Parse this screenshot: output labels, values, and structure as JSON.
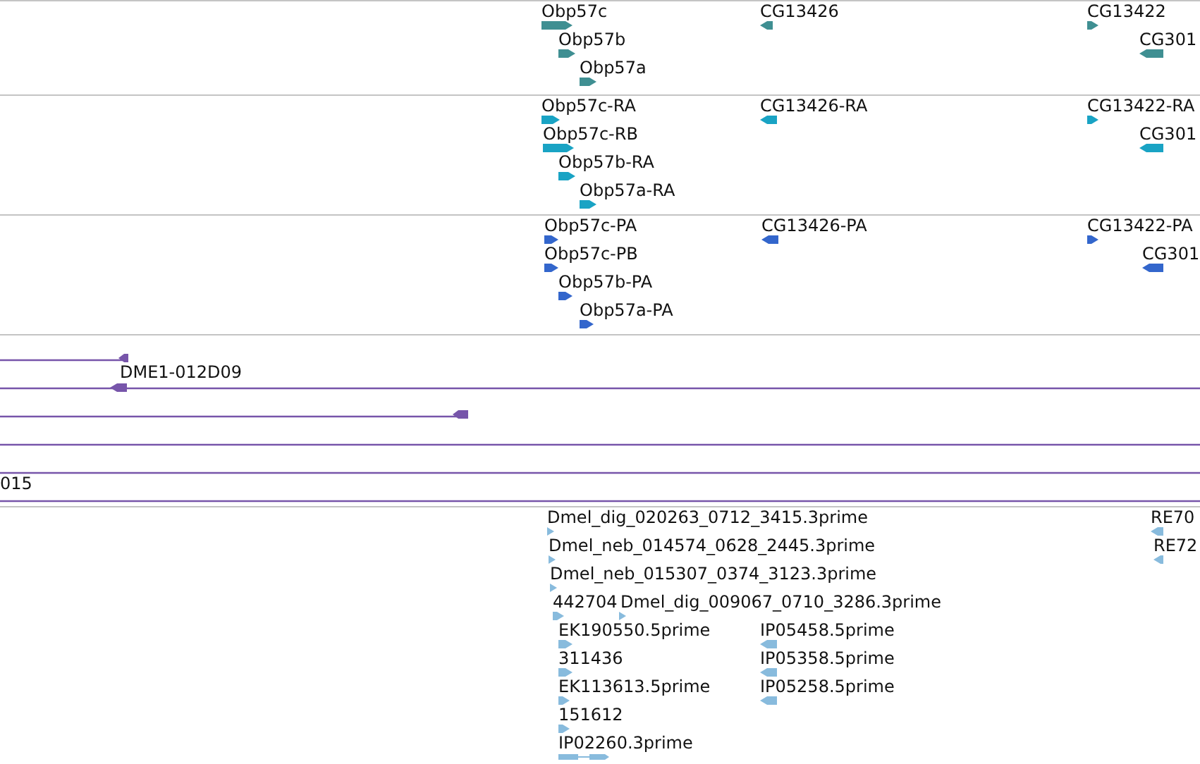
{
  "tracks": [
    {
      "color": "#3f8f92",
      "features": [
        {
          "label": "Obp57c",
          "reverse": false
        },
        {
          "label": "Obp57b",
          "reverse": false
        },
        {
          "label": "Obp57a",
          "reverse": false
        },
        {
          "label": "CG13426",
          "reverse": true
        },
        {
          "label": "CG13422",
          "reverse": false
        },
        {
          "label": "CG301",
          "reverse": true
        }
      ]
    },
    {
      "color": "#19a3c4",
      "features": [
        {
          "label": "Obp57c-RA",
          "reverse": false
        },
        {
          "label": "Obp57c-RB",
          "reverse": false
        },
        {
          "label": "Obp57b-RA",
          "reverse": false
        },
        {
          "label": "Obp57a-RA",
          "reverse": false
        },
        {
          "label": "CG13426-RA",
          "reverse": true
        },
        {
          "label": "CG13422-RA",
          "reverse": false
        },
        {
          "label": "CG301",
          "reverse": true
        }
      ]
    },
    {
      "color": "#3366cc",
      "features": [
        {
          "label": "Obp57c-PA",
          "reverse": false
        },
        {
          "label": "Obp57c-PB",
          "reverse": false
        },
        {
          "label": "Obp57b-PA",
          "reverse": false
        },
        {
          "label": "Obp57a-PA",
          "reverse": false
        },
        {
          "label": "CG13426-PA",
          "reverse": true
        },
        {
          "label": "CG13422-PA",
          "reverse": false
        },
        {
          "label": "CG301",
          "reverse": true
        }
      ]
    },
    {
      "color": "#7755aa",
      "features": [
        {
          "label": "DME1-012D09",
          "reverse": true
        },
        {
          "label": "015"
        }
      ]
    },
    {
      "color": "#88bbdd",
      "features": [
        {
          "label": "Dmel_dig_020263_0712_3415.3prime",
          "reverse": false
        },
        {
          "label": "Dmel_neb_014574_0628_2445.3prime",
          "reverse": false
        },
        {
          "label": "Dmel_neb_015307_0374_3123.3prime",
          "reverse": false
        },
        {
          "label": "442704",
          "reverse": false
        },
        {
          "label": "Dmel_dig_009067_0710_3286.3prime",
          "reverse": false
        },
        {
          "label": "EK190550.5prime",
          "reverse": false
        },
        {
          "label": "311436",
          "reverse": false
        },
        {
          "label": "EK113613.5prime",
          "reverse": false
        },
        {
          "label": "151612",
          "reverse": false
        },
        {
          "label": "IP02260.3prime",
          "reverse": false
        },
        {
          "label": "IP05458.5prime",
          "reverse": true
        },
        {
          "label": "IP05358.5prime",
          "reverse": true
        },
        {
          "label": "IP05258.5prime",
          "reverse": true
        },
        {
          "label": "RE70",
          "reverse": true
        },
        {
          "label": "RE72",
          "reverse": true
        }
      ]
    }
  ]
}
